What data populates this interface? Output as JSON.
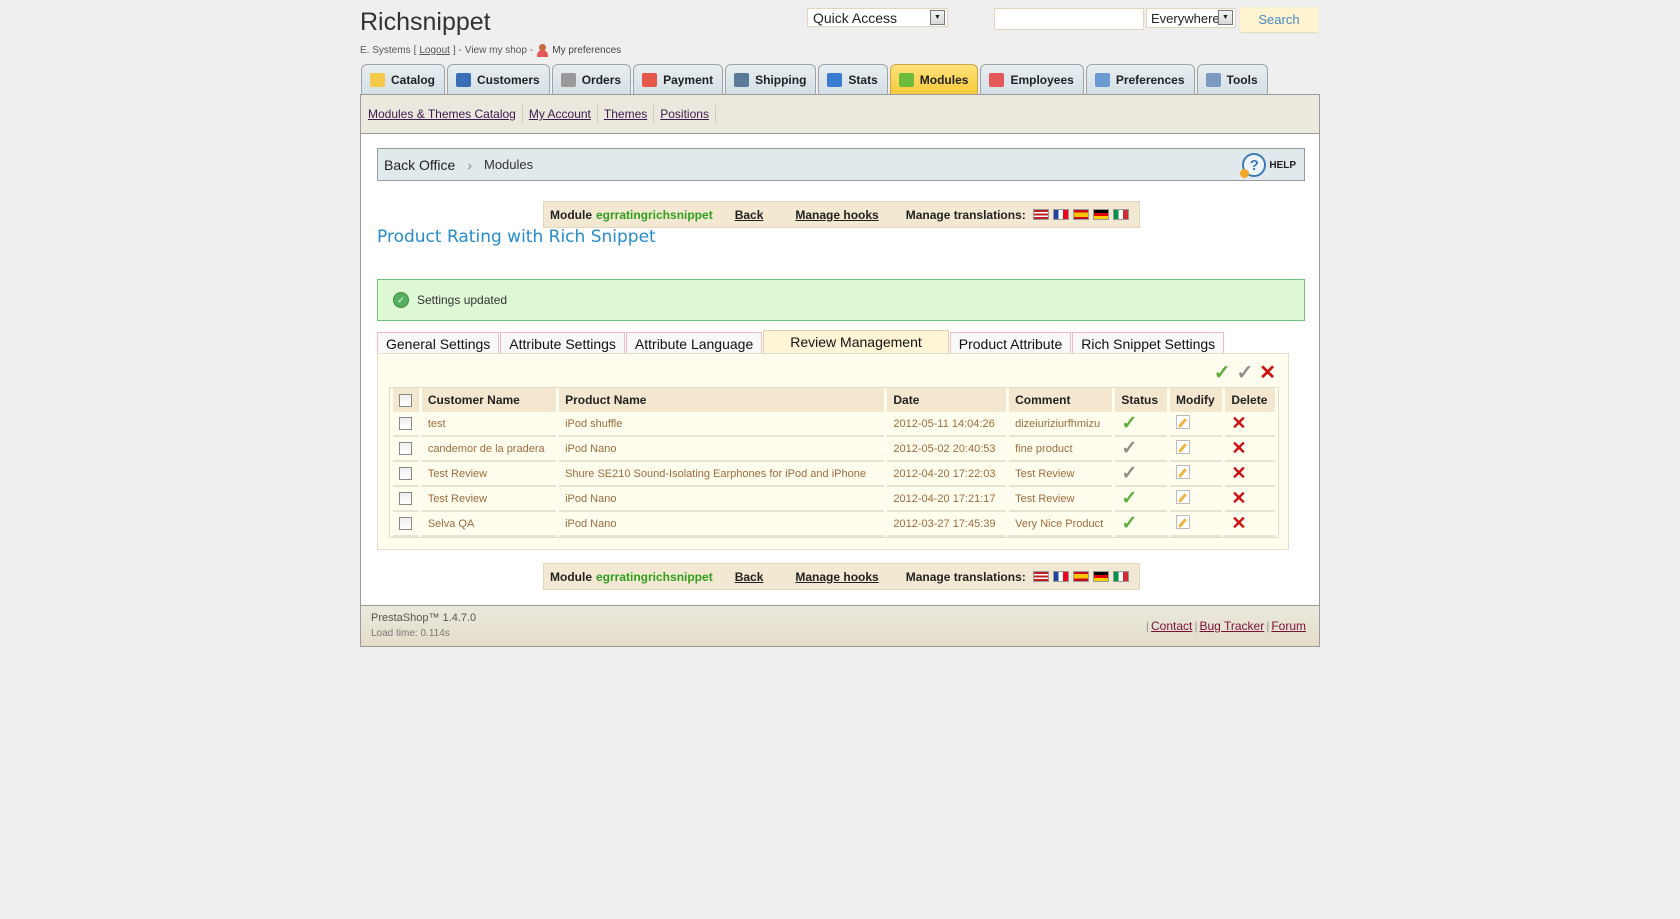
{
  "header": {
    "shop_title": "Richsnippet",
    "user_name": "E. Systems",
    "logout": "Logout",
    "view_shop": "View my shop",
    "my_preferences": "My preferences",
    "quick_access": "Quick Access",
    "search_value": "",
    "search_scope": "Everywhere",
    "search_button": "Search"
  },
  "tabs": [
    {
      "label": "Catalog",
      "icon": "folder-icon",
      "color": "#f4c94a"
    },
    {
      "label": "Customers",
      "icon": "customer-icon",
      "color": "#3a6fb5"
    },
    {
      "label": "Orders",
      "icon": "cart-icon",
      "color": "#9a9a9a"
    },
    {
      "label": "Payment",
      "icon": "payment-icon",
      "color": "#e4584a"
    },
    {
      "label": "Shipping",
      "icon": "truck-icon",
      "color": "#5a7a9a"
    },
    {
      "label": "Stats",
      "icon": "chart-icon",
      "color": "#3a7ad0"
    },
    {
      "label": "Modules",
      "icon": "puzzle-icon",
      "color": "#6dbb3c",
      "active": true
    },
    {
      "label": "Employees",
      "icon": "employee-icon",
      "color": "#e4585a"
    },
    {
      "label": "Preferences",
      "icon": "preferences-icon",
      "color": "#6a9ad0"
    },
    {
      "label": "Tools",
      "icon": "wrench-icon",
      "color": "#7a9ac0"
    }
  ],
  "subnav": [
    "Modules & Themes Catalog",
    "My Account",
    "Themes",
    "Positions"
  ],
  "breadcrumb": {
    "home": "Back Office",
    "current": "Modules",
    "help": "HELP"
  },
  "module_bar": {
    "module_label": "Module",
    "module_name": "egrratingrichsnippet",
    "back": "Back",
    "manage_hooks": "Manage hooks",
    "manage_translations": "Manage translations:",
    "flags": [
      "en",
      "fr",
      "es",
      "de",
      "it"
    ]
  },
  "page_title": "Product Rating with Rich Snippet",
  "success_message": "Settings updated",
  "panel_tabs": [
    {
      "label": "General Settings"
    },
    {
      "label": "Attribute Settings"
    },
    {
      "label": "Attribute Language"
    },
    {
      "label": "Review Management",
      "active": true
    },
    {
      "label": "Product Attribute"
    },
    {
      "label": "Rich Snippet Settings"
    }
  ],
  "table": {
    "columns": [
      "Customer Name",
      "Product Name",
      "Date",
      "Comment",
      "Status",
      "Modify",
      "Delete"
    ],
    "rows": [
      {
        "customer": "test",
        "product": "iPod shuffle",
        "date": "2012-05-11 14:04:26",
        "comment": "dizeiuriziurfhmizu",
        "status": "approved"
      },
      {
        "customer": "candemor de la pradera",
        "product": "iPod Nano",
        "date": "2012-05-02 20:40:53",
        "comment": "fine product",
        "status": "pending"
      },
      {
        "customer": "Test Review",
        "product": "Shure SE210 Sound-Isolating Earphones for iPod and iPhone",
        "date": "2012-04-20 17:22:03",
        "comment": "Test Review",
        "status": "pending"
      },
      {
        "customer": "Test Review",
        "product": "iPod Nano",
        "date": "2012-04-20 17:21:17",
        "comment": "Test Review",
        "status": "approved"
      },
      {
        "customer": "Selva QA",
        "product": "iPod Nano",
        "date": "2012-03-27 17:45:39",
        "comment": "Very Nice Product",
        "status": "approved"
      }
    ]
  },
  "footer": {
    "version": "PrestaShop™ 1.4.7.0",
    "load_time": "Load time: 0.114s",
    "links": [
      "Contact",
      "Bug Tracker",
      "Forum"
    ]
  }
}
